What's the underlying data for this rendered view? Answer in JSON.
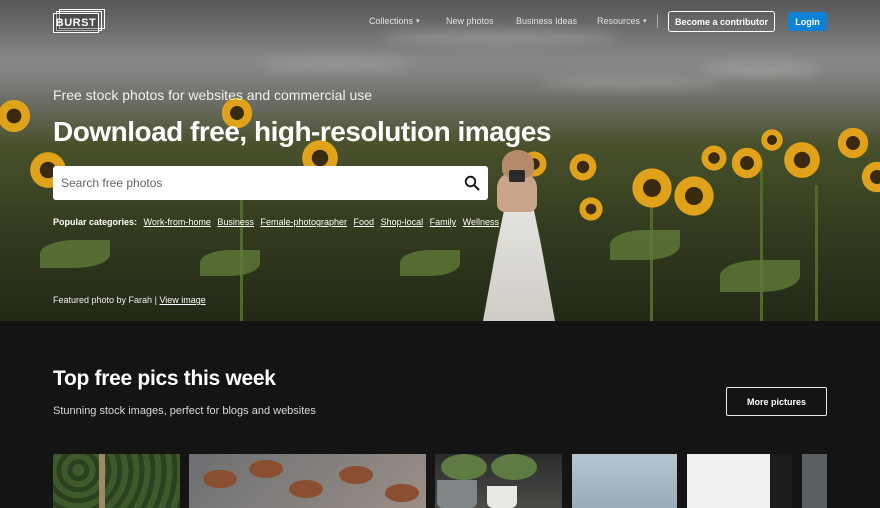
{
  "header": {
    "logo_text": "BURST",
    "nav": [
      {
        "label": "Collections",
        "has_dropdown": true
      },
      {
        "label": "New photos",
        "has_dropdown": false
      },
      {
        "label": "Business Ideas",
        "has_dropdown": false
      },
      {
        "label": "Resources",
        "has_dropdown": true
      }
    ],
    "contributor_button": "Become a contributor",
    "login_button": "Login"
  },
  "hero": {
    "subtitle": "Free stock photos for websites and commercial use",
    "title": "Download free, high-resolution images",
    "search": {
      "placeholder": "Search free photos",
      "value": ""
    },
    "popular_label": "Popular categories:",
    "popular_categories": [
      "Work-from-home",
      "Business",
      "Female-photographer",
      "Food",
      "Shop-local",
      "Family",
      "Wellness"
    ],
    "featured_prefix": "Featured photo by Farah",
    "featured_sep": "|",
    "featured_link": "View image"
  },
  "section": {
    "title": "Top free pics this week",
    "subtitle": "Stunning stock images, perfect for blogs and websites",
    "more_button": "More pictures"
  },
  "colors": {
    "accent": "#0f82d8",
    "page_background": "#141414"
  },
  "icons": {
    "search": "search-icon",
    "dropdown": "caret-down-icon"
  }
}
